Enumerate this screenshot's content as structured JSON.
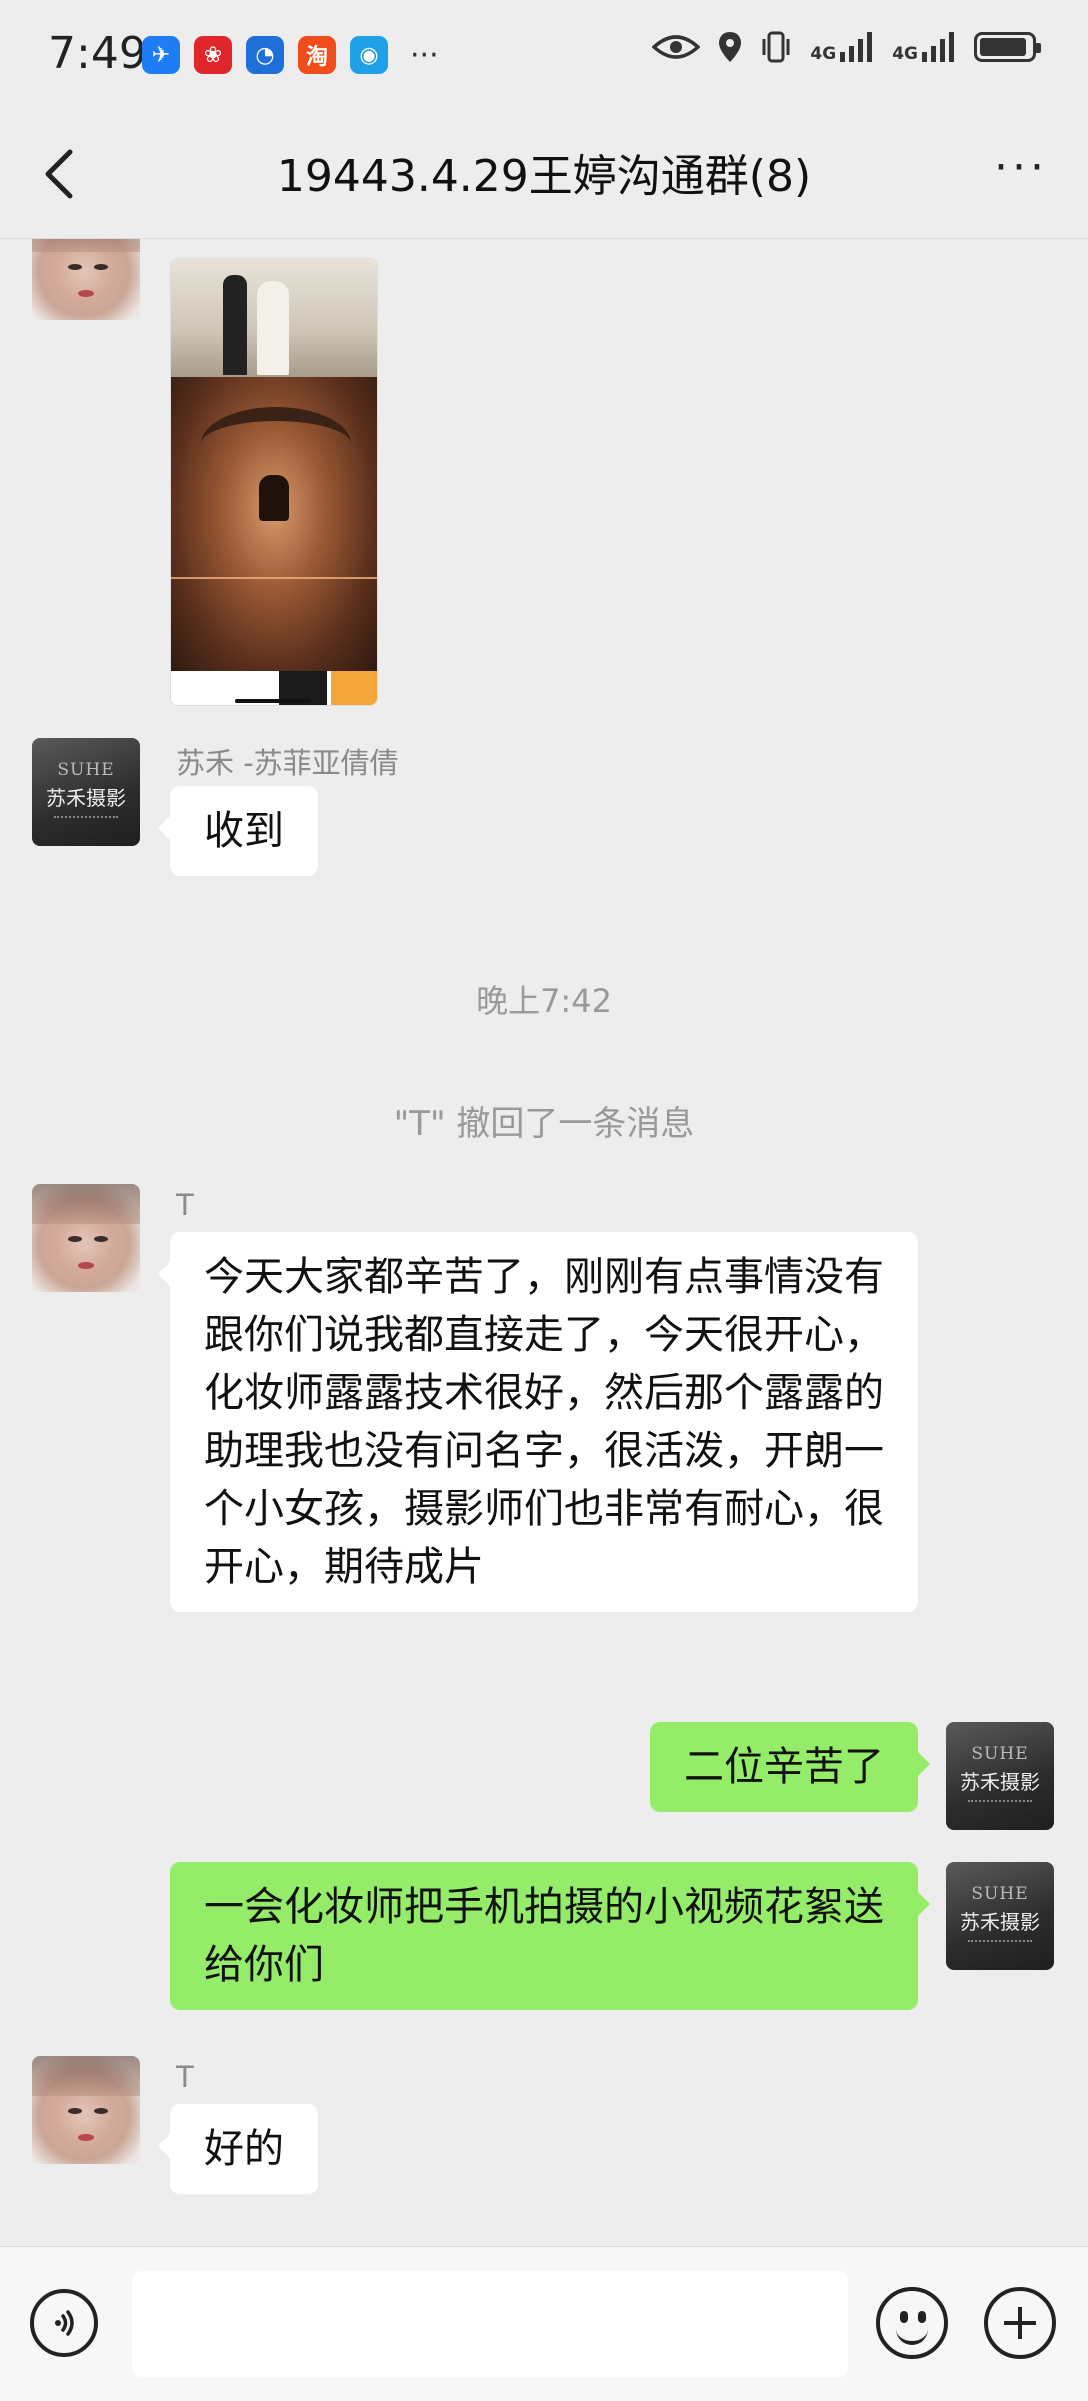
{
  "status_bar": {
    "time": "7:49",
    "app_icons": [
      {
        "name": "feishu-icon",
        "glyph": "✈",
        "color": "#1e7cf5"
      },
      {
        "name": "pinduoduo-icon",
        "glyph": "❀",
        "color": "#e0252b"
      },
      {
        "name": "bulb-icon",
        "glyph": "💡",
        "color": "#1f6fd8"
      },
      {
        "name": "taobao-icon",
        "glyph": "淘",
        "color": "#f04d1a"
      },
      {
        "name": "browser-icon",
        "glyph": "◉",
        "color": "#1fa1e8"
      }
    ],
    "more": "···",
    "network_1": "4G",
    "network_2": "4G"
  },
  "nav": {
    "title": "19443.4.29王婷沟通群(8)",
    "more": "···"
  },
  "messages": {
    "m1_sender": "苏禾 -苏菲亚倩倩",
    "m1_text": "收到",
    "time_divider": "晚上7:42",
    "recall_notice": "\"T\" 撤回了一条消息",
    "m2_sender": "T",
    "m2_text": "今天大家都辛苦了，刚刚有点事情没有跟你们说我都直接走了，今天很开心，化妆师露露技术很好，然后那个露露的助理我也没有问名字，很活泼，开朗一个小女孩，摄影师们也非常有耐心，很开心，期待成片",
    "m3_text": "二位辛苦了",
    "m4_text": "一会化妆师把手机拍摄的小视频花絮送给你们",
    "m5_sender": "T",
    "m5_text": "好的",
    "top_sender": "T"
  },
  "avatar_logo": {
    "line1": "SUHE",
    "line2": "苏禾摄影"
  },
  "input_bar": {
    "placeholder": ""
  },
  "colors": {
    "background": "#ededed",
    "outgoing_bubble": "#95ec69",
    "incoming_bubble": "#ffffff"
  }
}
